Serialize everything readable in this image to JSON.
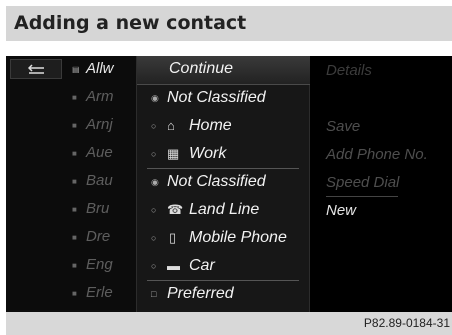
{
  "header": {
    "title": "Adding a new contact"
  },
  "footer": {
    "code": "P82.89-0184-31"
  },
  "left_list": {
    "items": [
      {
        "label": "Allw",
        "active": true
      },
      {
        "label": "Arm",
        "active": false
      },
      {
        "label": "Arnj",
        "active": false
      },
      {
        "label": "Aue",
        "active": false
      },
      {
        "label": "Bau",
        "active": false
      },
      {
        "label": "Bru",
        "active": false
      },
      {
        "label": "Dre",
        "active": false
      },
      {
        "label": "Eng",
        "active": false
      },
      {
        "label": "Erle",
        "active": false
      }
    ]
  },
  "menu": {
    "continue_label": "Continue",
    "items": [
      {
        "label": "Not Classified",
        "type": "radio",
        "selected": true
      },
      {
        "label": "Home",
        "type": "radio",
        "icon": "home-icon"
      },
      {
        "label": "Work",
        "type": "radio",
        "icon": "work-icon"
      },
      {
        "label": "Not Classified",
        "type": "radio",
        "selected": true
      },
      {
        "label": "Land Line",
        "type": "radio",
        "icon": "landline-phone-icon"
      },
      {
        "label": "Mobile Phone",
        "type": "radio",
        "icon": "mobile-phone-icon"
      },
      {
        "label": "Car",
        "type": "radio",
        "icon": "car-icon"
      },
      {
        "label": "Preferred",
        "type": "checkbox",
        "selected": false
      }
    ]
  },
  "right_menu": {
    "items": [
      {
        "label": "Details",
        "enabled": false
      },
      {
        "label": "Save",
        "enabled": false
      },
      {
        "label": "Add Phone No.",
        "enabled": false
      },
      {
        "label": "Speed Dial",
        "enabled": false
      },
      {
        "label": "New",
        "enabled": true
      }
    ]
  },
  "colors": {
    "screen_bg": "#000000",
    "highlight": "#3a3a3a",
    "active_text": "#f2f2f2",
    "dim_text": "#5e5e5e"
  }
}
